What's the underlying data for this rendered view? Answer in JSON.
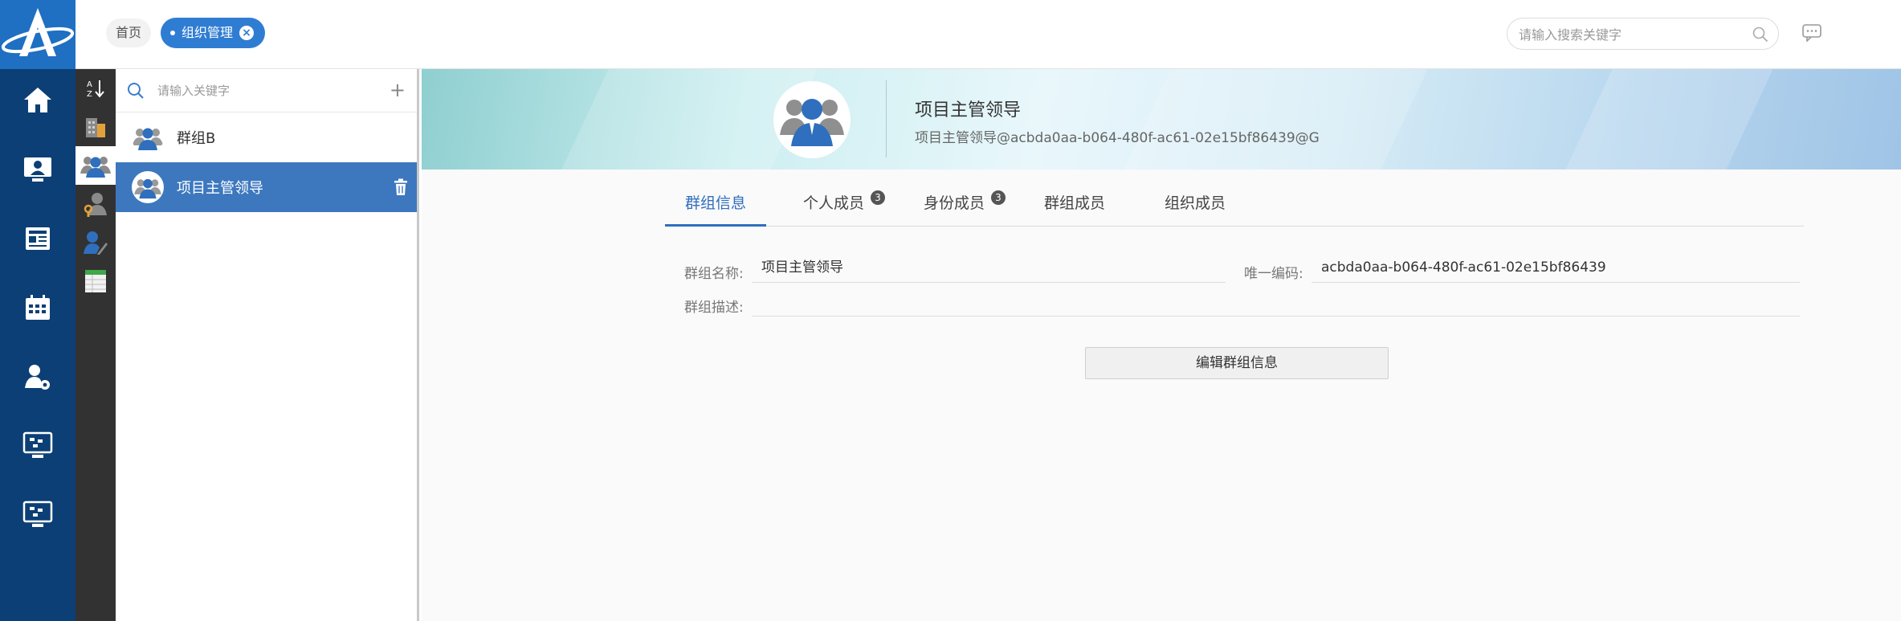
{
  "header": {
    "breadcrumb_home": "首页",
    "active_tab": "组织管理",
    "search_placeholder": "请输入搜索关键字"
  },
  "nav": {
    "items": [
      "home-icon",
      "monitor-user-icon",
      "news-icon",
      "calendar-icon",
      "user-settings-icon",
      "dashboard-icon",
      "dashboard-alt-icon"
    ]
  },
  "strip": {
    "items": [
      "sort-az-icon",
      "building-icon",
      "group-icon",
      "role-key-icon",
      "user-edit-icon",
      "table-icon"
    ],
    "active_index": 2
  },
  "group_list": {
    "search_placeholder": "请输入关键字",
    "add_label": "+",
    "items": [
      {
        "name": "群组B",
        "selected": false
      },
      {
        "name": "项目主管领导",
        "selected": true
      }
    ]
  },
  "detail": {
    "title": "项目主管领导",
    "email": "项目主管领导@acbda0aa-b064-480f-ac61-02e15bf86439@G",
    "tabs": [
      {
        "label": "群组信息",
        "active": true
      },
      {
        "label": "个人成员",
        "badge": "3"
      },
      {
        "label": "身份成员",
        "badge": "3"
      },
      {
        "label": "群组成员"
      },
      {
        "label": "组织成员"
      }
    ],
    "fields": {
      "name_label": "群组名称:",
      "name_value": "项目主管领导",
      "code_label": "唯一编码:",
      "code_value": "acbda0aa-b064-480f-ac61-02e15bf86439",
      "desc_label": "群组描述:",
      "desc_value": ""
    },
    "edit_button": "编辑群组信息"
  },
  "colors": {
    "brand_blue": "#1f6fc2",
    "nav_bg": "#0c3f75",
    "strip_bg": "#323232",
    "selected_row": "#3d78bf",
    "active_tab": "#2f6fbd"
  }
}
